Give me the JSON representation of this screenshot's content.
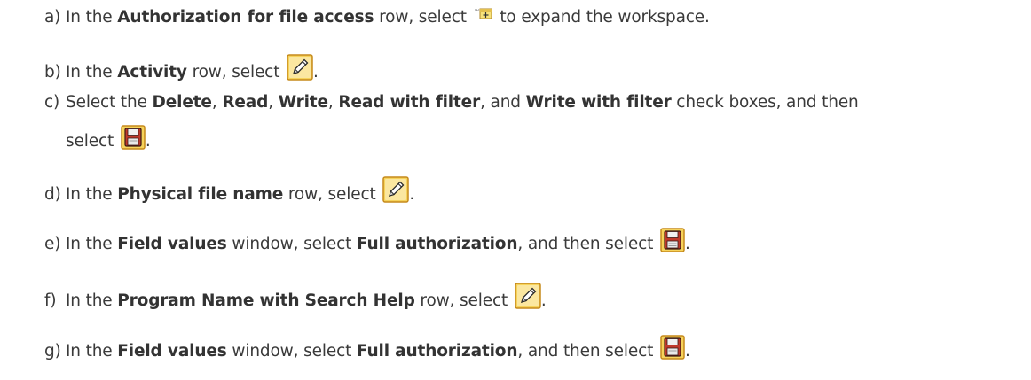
{
  "steps": [
    {
      "letter": "a)",
      "parts": [
        "In the ",
        "Authorization for file access",
        " row, select ",
        " to expand the workspace."
      ],
      "icon": "expand-workspace-icon"
    },
    {
      "letter": "b)",
      "parts": [
        "In the ",
        "Activity",
        " row, select ",
        "."
      ],
      "icon": "pencil-edit-icon"
    },
    {
      "letter": "c)",
      "parts": [
        "Select the ",
        "Delete",
        ", ",
        "Read",
        ", ",
        "Write",
        ", ",
        "Read with filter",
        ", and ",
        "Write with filter",
        " check boxes, and then"
      ],
      "continuation": [
        "select ",
        "."
      ],
      "icon": "save-floppy-icon"
    },
    {
      "letter": "d)",
      "parts": [
        "In the ",
        "Physical file name",
        " row, select ",
        "."
      ],
      "icon": "pencil-edit-icon"
    },
    {
      "letter": "e)",
      "parts": [
        "In the ",
        "Field values",
        " window, select ",
        "Full authorization",
        ", and then select ",
        "."
      ],
      "icon": "save-floppy-icon"
    },
    {
      "letter": "f)",
      "parts": [
        "In the ",
        "Program Name with Search Help",
        " row, select ",
        "."
      ],
      "icon": "pencil-edit-icon"
    },
    {
      "letter": "g)",
      "parts": [
        "In the ",
        "Field values",
        " window, select ",
        "Full authorization",
        ", and then select ",
        "."
      ],
      "icon": "save-floppy-icon"
    }
  ],
  "colors": {
    "text": "#3a3a3a",
    "icon_yellow": "#f5d35a",
    "icon_frame": "#c58a1c",
    "floppy_red": "#c0392b"
  }
}
